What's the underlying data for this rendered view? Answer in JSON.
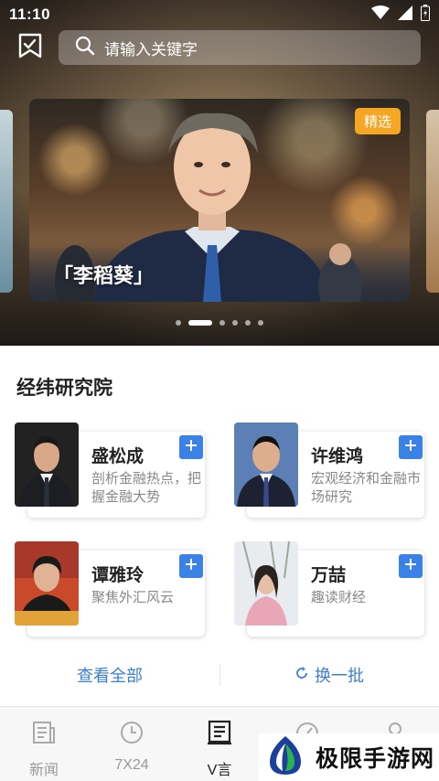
{
  "status_bar": {
    "time": "11:10"
  },
  "search": {
    "placeholder": "请输入关键字"
  },
  "banner": {
    "badge": "精选",
    "caption": "「李稻葵」",
    "slide_count": 6,
    "active_slide": 1
  },
  "section": {
    "title": "经纬研究院"
  },
  "experts": [
    {
      "name": "盛松成",
      "desc": "剖析金融热点，把握金融大势"
    },
    {
      "name": "许维鸿",
      "desc": "宏观经济和金融市场研究"
    },
    {
      "name": "谭雅玲",
      "desc": "聚焦外汇风云"
    },
    {
      "name": "万喆",
      "desc": "趣读财经"
    }
  ],
  "actions": {
    "view_all": "查看全部",
    "refresh": "换一批"
  },
  "nav": [
    {
      "label": "新闻",
      "icon": "news-icon"
    },
    {
      "label": "7X24",
      "icon": "clock-icon"
    },
    {
      "label": "V言",
      "icon": "article-icon"
    },
    {
      "label": "",
      "icon": "gauge-icon"
    },
    {
      "label": "",
      "icon": "user-icon"
    }
  ],
  "watermark": {
    "text": "极限手游网"
  },
  "colors": {
    "accent": "#3b82e6",
    "link": "#3a7fd5",
    "badge": "#f5a623"
  }
}
